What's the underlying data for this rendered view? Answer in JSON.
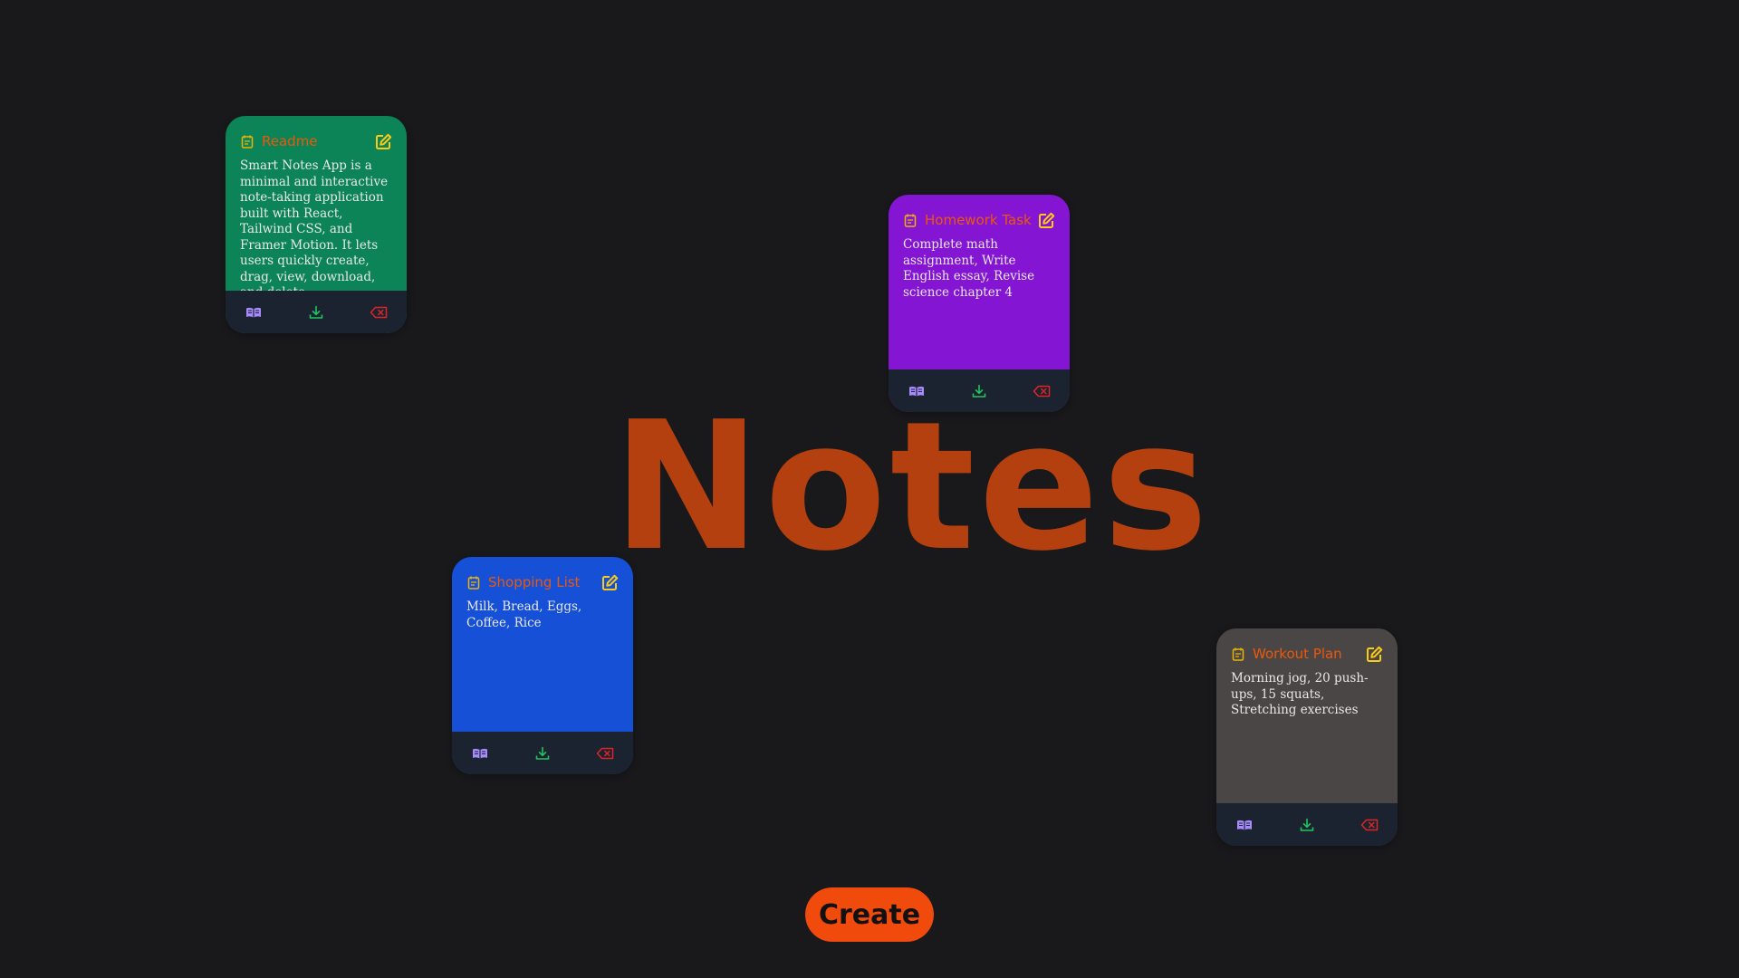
{
  "app": {
    "heading": "Notes",
    "create_label": "Create"
  },
  "colors": {
    "background": "#19181b",
    "heading": "#b5400f",
    "card_title": "#ea580c",
    "footer": "#1b2230",
    "create_button": "#f04a0c",
    "icon_note": "#eab308",
    "icon_edit": "#facc15",
    "icon_read": "#a78bfa",
    "icon_download": "#22c55e",
    "icon_delete": "#dc2626"
  },
  "notes": [
    {
      "title": "Readme",
      "text": "Smart Notes App is a minimal and interactive note-taking application built with React, Tailwind CSS, and Framer Motion. It lets users quickly create, drag, view, download, and delete",
      "color": "#0c8457"
    },
    {
      "title": "Homework Task",
      "text": "Complete math assignment, Write English essay, Revise science chapter 4",
      "color": "#8415d3"
    },
    {
      "title": "Shopping List",
      "text": "Milk, Bread, Eggs, Coffee, Rice",
      "color": "#1650d6"
    },
    {
      "title": "Workout Plan",
      "text": "Morning jog, 20 push-ups, 15 squats, Stretching exercises",
      "color": "#4a4645"
    }
  ],
  "icons": {
    "note": "note-icon",
    "edit": "edit-icon",
    "read": "read-icon",
    "download": "download-icon",
    "delete": "delete-icon"
  }
}
